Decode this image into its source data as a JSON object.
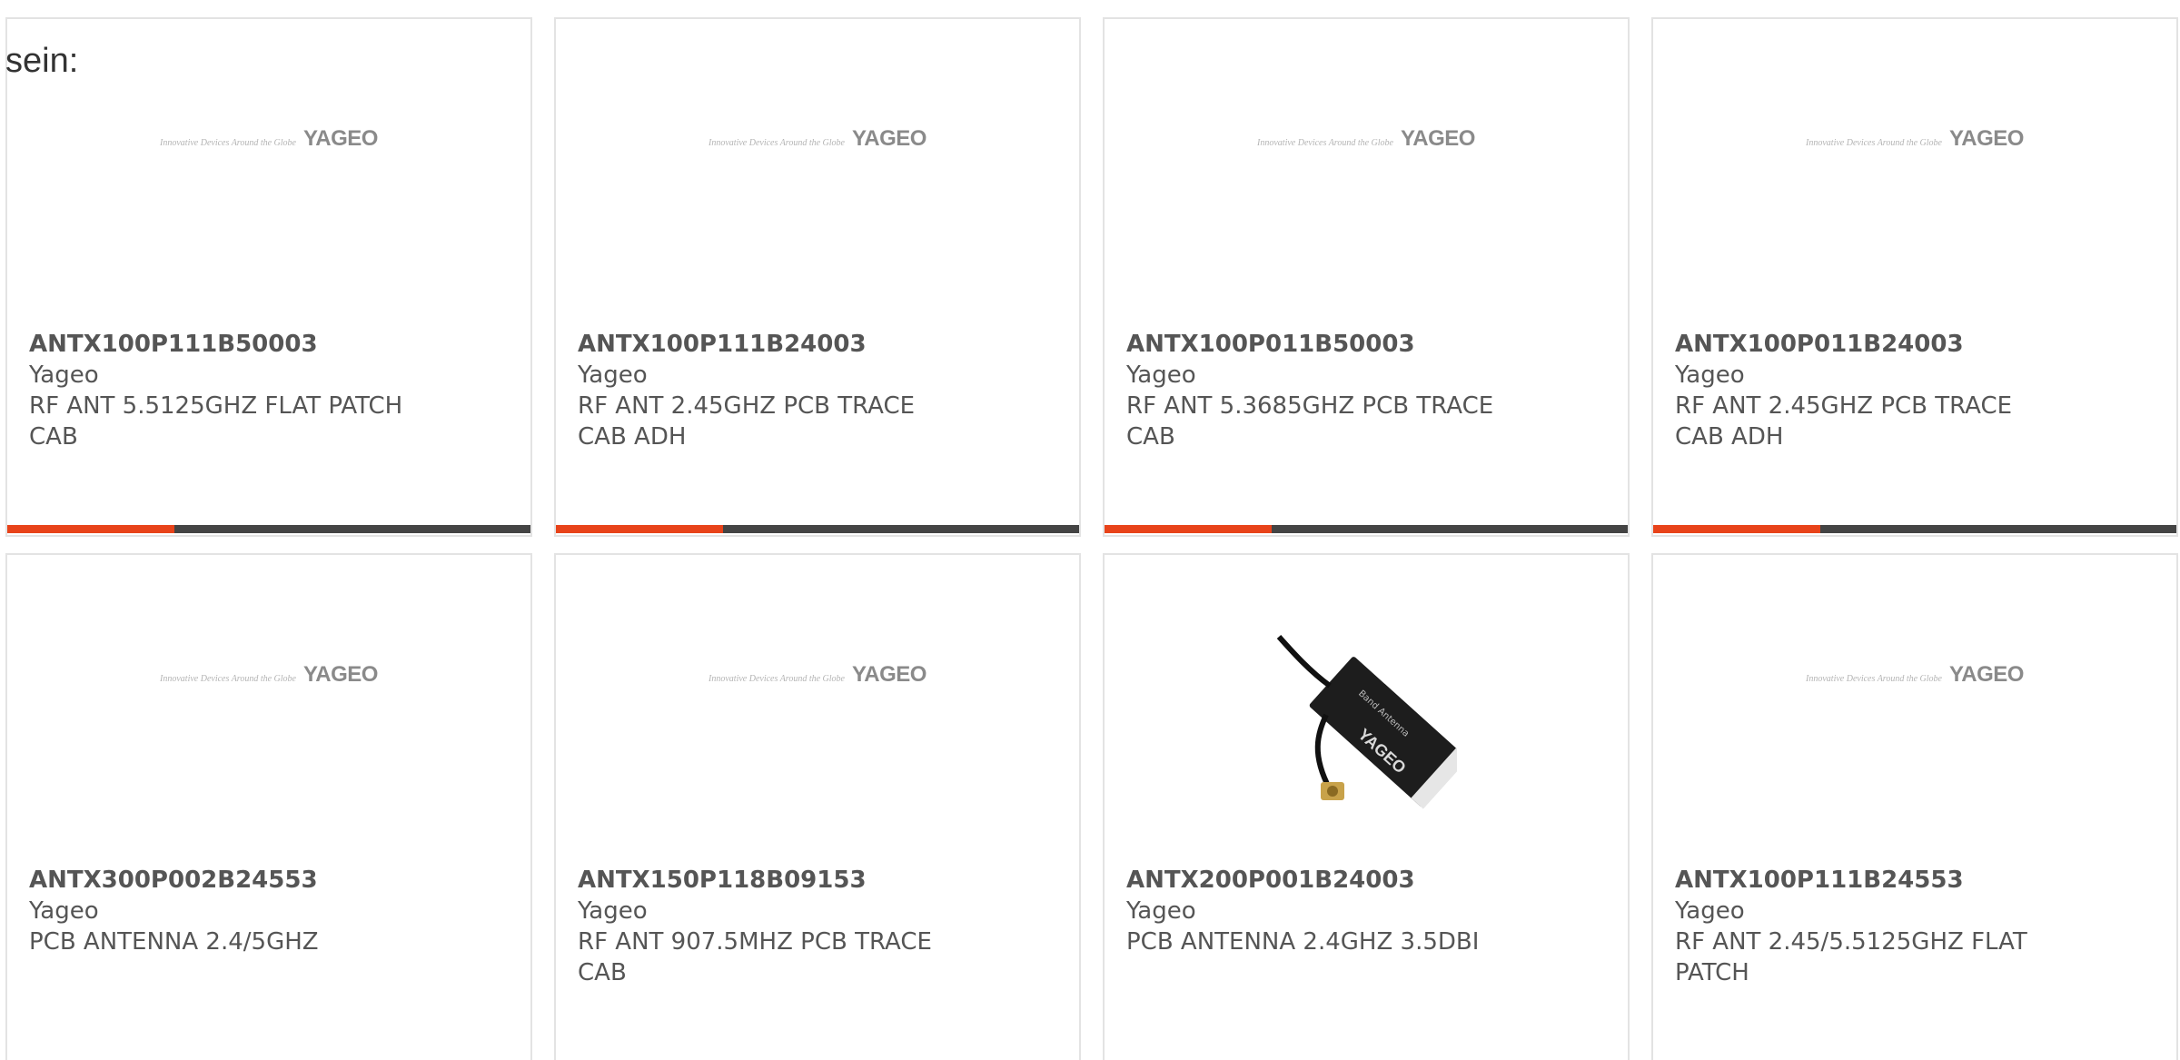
{
  "intro_text": "sein:",
  "colors": {
    "accent": "#e8431a",
    "bar_dark": "#444444",
    "border": "#e3e3e3",
    "text": "#555555"
  },
  "logo": {
    "brand": "YAGEO",
    "tagline": "Innovative Devices Around the Globe"
  },
  "products": [
    {
      "part_number": "ANTX100P111B50003",
      "manufacturer": "Yageo",
      "description": "RF ANT 5.5125GHZ FLAT PATCH CAB",
      "image": "yageo-logo",
      "progress": 0.32
    },
    {
      "part_number": "ANTX100P111B24003",
      "manufacturer": "Yageo",
      "description": "RF ANT 2.45GHZ PCB TRACE CAB ADH",
      "image": "yageo-logo",
      "progress": 0.32
    },
    {
      "part_number": "ANTX100P011B50003",
      "manufacturer": "Yageo",
      "description": "RF ANT 5.3685GHZ PCB TRACE CAB",
      "image": "yageo-logo",
      "progress": 0.32
    },
    {
      "part_number": "ANTX100P011B24003",
      "manufacturer": "Yageo",
      "description": "RF ANT 2.45GHZ PCB TRACE CAB ADH",
      "image": "yageo-logo",
      "progress": 0.32
    },
    {
      "part_number": "ANTX300P002B24553",
      "manufacturer": "Yageo",
      "description": "PCB ANTENNA 2.4/5GHZ",
      "image": "yageo-logo"
    },
    {
      "part_number": "ANTX150P118B09153",
      "manufacturer": "Yageo",
      "description": "RF ANT 907.5MHZ PCB TRACE CAB",
      "image": "yageo-logo"
    },
    {
      "part_number": "ANTX200P001B24003",
      "manufacturer": "Yageo",
      "description": "PCB ANTENNA 2.4GHZ 3.5DBI",
      "image": "antenna-photo",
      "photo_label": "Band Antenna"
    },
    {
      "part_number": "ANTX100P111B24553",
      "manufacturer": "Yageo",
      "description": "RF ANT 2.45/5.5125GHZ FLAT PATCH",
      "image": "yageo-logo"
    }
  ]
}
